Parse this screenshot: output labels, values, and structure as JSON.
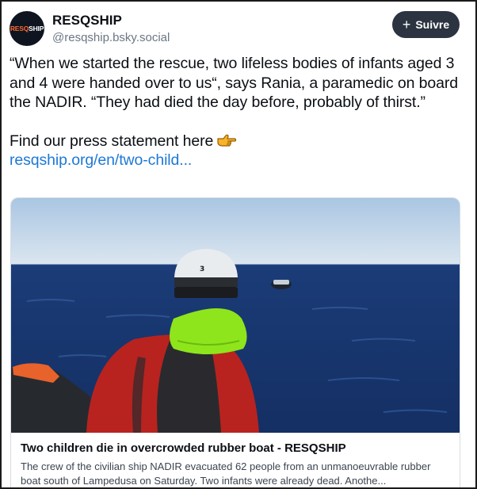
{
  "account": {
    "avatar_text_a": "RESQ",
    "avatar_text_b": "SHIP",
    "display_name": "RESQSHIP",
    "handle": "@resqship.bsky.social"
  },
  "follow_button": {
    "icon": "+",
    "label": "Suivre"
  },
  "post": {
    "paragraph_1": "“When we started the rescue, two lifeless bodies of infants aged 3 and 4 were handed over to us“, says Rania, a paramedic on board the NADIR. “They had died the day before, probably of thirst.”",
    "paragraph_2": "Find our press statement here",
    "emoji": "pointing-right-hand-icon",
    "link_text": "resqship.org/en/two-child..."
  },
  "link_card": {
    "title": "Two children die in overcrowded rubber boat - RESQSHIP",
    "description": "The crew of the civilian ship NADIR evacuated 62 people from an unmanoeuvrable rubber boat south of Lampedusa on Saturday. Two infants were already dead. Anothe...",
    "helmet_number": "3"
  },
  "colors": {
    "follow_button_bg": "#2b3440",
    "link": "#1d78d6",
    "brand_orange": "#ff6a2a",
    "sea": "#1d3f7c",
    "jacket_red": "#b8231f",
    "hood_green": "#8ee51c"
  }
}
